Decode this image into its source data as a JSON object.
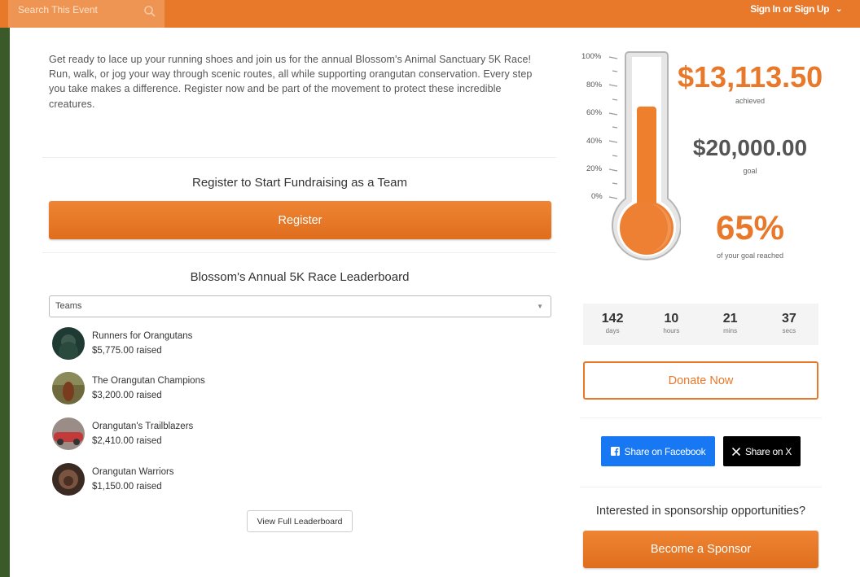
{
  "header": {
    "search_placeholder": "Search This Event",
    "signin_label": "Sign In or Sign Up"
  },
  "intro": {
    "text": "Get ready to lace up your running shoes and join us for the annual Blossom's Animal Sanctuary 5K Race! Run, walk, or jog your way through scenic routes, all while supporting orangutan conservation. Every step you take makes a difference. Register now and be part of the movement to protect these incredible creatures."
  },
  "register_section": {
    "title": "Register to Start Fundraising as a Team",
    "button_label": "Register"
  },
  "leaderboard": {
    "title": "Blossom's Annual 5K Race Leaderboard",
    "select_value": "Teams",
    "teams": [
      {
        "name": "Runners for Orangutans",
        "raised": "$5,775.00 raised"
      },
      {
        "name": "The Orangutan Champions",
        "raised": "$3,200.00 raised"
      },
      {
        "name": "Orangutan's Trailblazers",
        "raised": "$2,410.00 raised"
      },
      {
        "name": "Orangutan Warriors",
        "raised": "$1,150.00 raised"
      }
    ],
    "view_full_label": "View Full Leaderboard"
  },
  "progress": {
    "fill_fraction": 0.65,
    "scale_labels": [
      "100%",
      "80%",
      "60%",
      "40%",
      "20%",
      "0%"
    ],
    "achieved_amount": "$13,113.50",
    "achieved_label": "achieved",
    "goal_amount": "$20,000.00",
    "goal_label": "goal",
    "percent": "65%",
    "percent_label": "of your goal reached"
  },
  "countdown": [
    {
      "value": "142",
      "unit": "days"
    },
    {
      "value": "10",
      "unit": "hours"
    },
    {
      "value": "21",
      "unit": "mins"
    },
    {
      "value": "37",
      "unit": "secs"
    }
  ],
  "actions": {
    "donate_label": "Donate Now",
    "facebook_label": "Share on Facebook",
    "x_label": "Share on X",
    "sponsor_question": "Interested in sponsorship opportunities?",
    "sponsor_label": "Become a Sponsor"
  },
  "colors": {
    "brand_orange": "#e8782a",
    "facebook_blue": "#1877f2",
    "sidebar_green": "#3b5a2a"
  },
  "icons": [
    "search-icon",
    "chevron-down-icon",
    "facebook-icon",
    "x-icon",
    "thermometer-icon"
  ]
}
